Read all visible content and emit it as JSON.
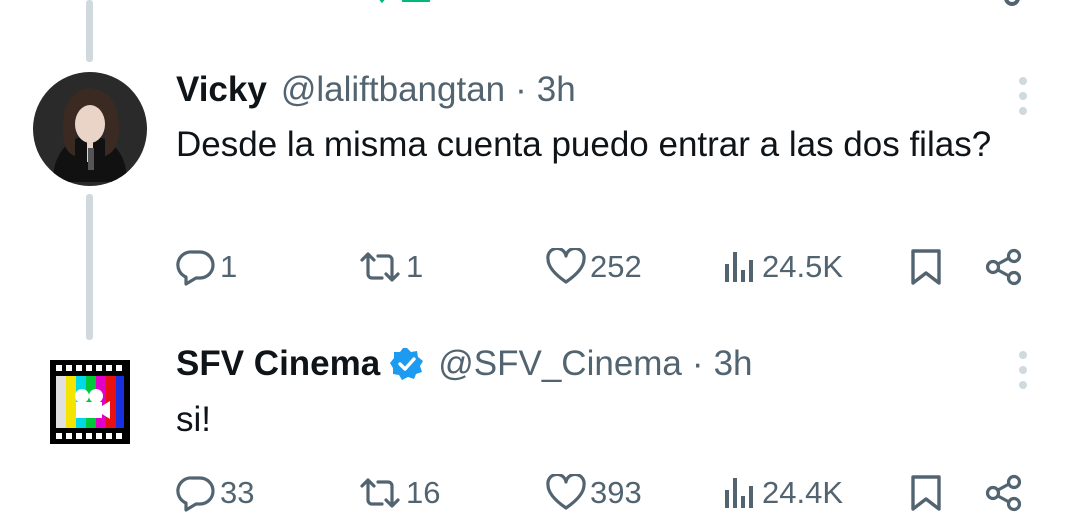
{
  "tweets": [
    {
      "name": "Vicky",
      "handle": "@laliftbangtan",
      "separator": "·",
      "time": "3h",
      "text": "Desde la misma cuenta puedo entrar a las dos filas?",
      "verified": false,
      "replies": "1",
      "retweets": "1",
      "likes": "252",
      "views": "24.5K"
    },
    {
      "name": "SFV Cinema",
      "handle": "@SFV_Cinema",
      "separator": "·",
      "time": "3h",
      "text": "si!",
      "verified": true,
      "replies": "33",
      "retweets": "16",
      "likes": "393",
      "views": "24.4K"
    }
  ],
  "icons": {
    "reply": "comment-icon",
    "retweet": "retweet-icon",
    "like": "heart-icon",
    "views": "views-icon",
    "bookmark": "bookmark-icon",
    "share": "share-icon",
    "more": "more-vertical-icon",
    "verified": "verified-badge-icon"
  },
  "colors": {
    "text": "#0f1419",
    "secondary": "#536471",
    "thread_line": "#cfd9de",
    "verified": "#1d9bf0",
    "retweet_active": "#00ba7c",
    "like_active": "#f91880"
  }
}
